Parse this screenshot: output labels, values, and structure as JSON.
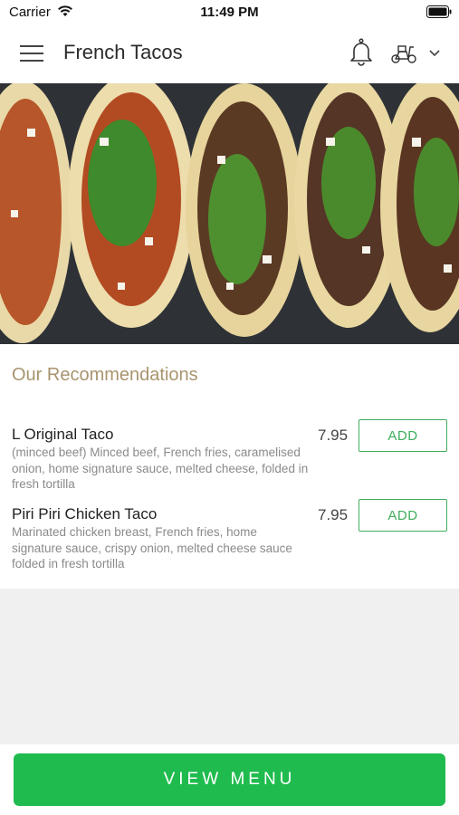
{
  "status_bar": {
    "carrier": "Carrier",
    "time": "11:49 PM"
  },
  "header": {
    "title": "French Tacos",
    "icons": [
      "menu-icon",
      "bell-icon",
      "scooter-icon",
      "chevron-down-icon"
    ]
  },
  "hero": {
    "image": "tacos-banner"
  },
  "recommendations": {
    "title": "Our Recommendations",
    "items": [
      {
        "name": "L Original Taco",
        "description": "(minced beef) Minced beef, French fries, caramelised onion, home signature sauce, melted cheese, folded in fresh tortilla",
        "price": "7.95",
        "button_label": "ADD"
      },
      {
        "name": "Piri Piri Chicken Taco",
        "description": "Marinated chicken breast, French fries, home signature sauce, crispy onion, melted cheese sauce folded in fresh tortilla",
        "price": "7.95",
        "button_label": "ADD"
      }
    ]
  },
  "footer": {
    "view_menu_label": "VIEW MENU"
  },
  "colors": {
    "accent_green": "#1fbb4e",
    "add_border": "#3fae5c",
    "section_title": "#a8946e"
  }
}
